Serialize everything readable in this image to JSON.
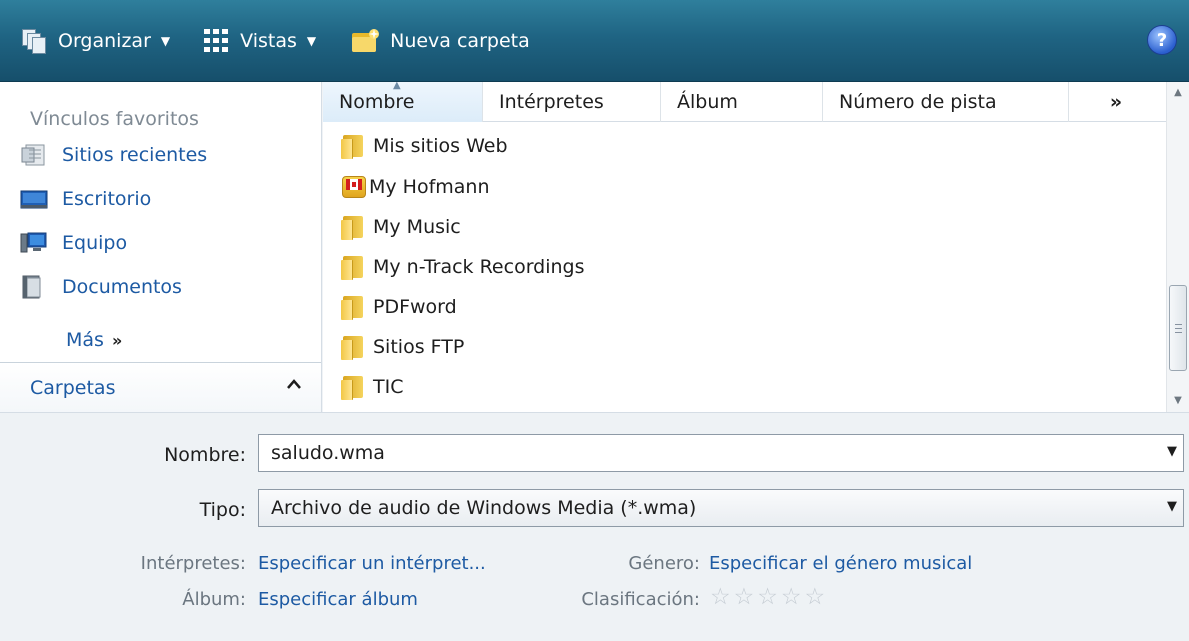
{
  "toolbar": {
    "organize_label": "Organizar",
    "views_label": "Vistas",
    "new_folder_label": "Nueva carpeta",
    "help_label": "?"
  },
  "nav": {
    "favorites_header": "Vínculos favoritos",
    "items": [
      {
        "label": "Sitios recientes",
        "icon": "recent-sites-icon"
      },
      {
        "label": "Escritorio",
        "icon": "desktop-icon"
      },
      {
        "label": "Equipo",
        "icon": "computer-icon"
      },
      {
        "label": "Documentos",
        "icon": "documents-icon"
      }
    ],
    "more_label": "Más",
    "more_chevron": "»",
    "folders_label": "Carpetas",
    "folders_chevron": "^"
  },
  "columns": {
    "name": "Nombre",
    "artists": "Intérpretes",
    "album": "Álbum",
    "track": "Número de pista",
    "more": "»"
  },
  "files": [
    {
      "name": "Mis sitios Web",
      "icon": "folder-icon"
    },
    {
      "name": "My Hofmann",
      "icon": "hofmann-icon"
    },
    {
      "name": "My Music",
      "icon": "folder-icon"
    },
    {
      "name": "My n-Track Recordings",
      "icon": "folder-icon"
    },
    {
      "name": "PDFword",
      "icon": "folder-icon"
    },
    {
      "name": "Sitios FTP",
      "icon": "folder-icon"
    },
    {
      "name": "TIC",
      "icon": "folder-icon"
    }
  ],
  "form": {
    "name_label": "Nombre:",
    "name_value": "saludo.wma",
    "type_label": "Tipo:",
    "type_value": "Archivo de audio de Windows Media (*.wma)",
    "artists_label": "Intérpretes:",
    "artists_link": "Especificar un intérpret...",
    "album_label": "Álbum:",
    "album_link": "Especificar álbum",
    "genre_label": "Género:",
    "genre_link": "Especificar el género musical",
    "rating_label": "Clasificación:",
    "rating_value": 0,
    "rating_max": 5
  },
  "colors": {
    "toolbar": "#1f6483",
    "link": "#1d5aa3",
    "background": "#eef2f5"
  }
}
